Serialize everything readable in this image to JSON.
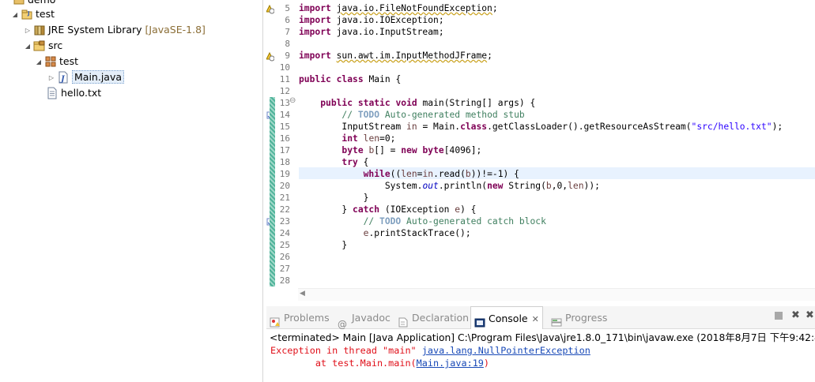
{
  "explorer": {
    "items": [
      {
        "label": "demo"
      },
      {
        "label": "test"
      },
      {
        "label": "JRE System Library",
        "decoration": "[JavaSE-1.8]"
      },
      {
        "label": "src"
      },
      {
        "label": "test"
      },
      {
        "label": "Main.java"
      },
      {
        "label": "hello.txt"
      }
    ]
  },
  "editor": {
    "lines": [
      {
        "n": "5",
        "tokens": [
          {
            "t": "import",
            "c": "kw"
          },
          {
            "t": " "
          },
          {
            "t": "java.io.FileNotFoundException",
            "c": "wv"
          },
          {
            "t": ";"
          }
        ]
      },
      {
        "n": "6",
        "tokens": [
          {
            "t": "import",
            "c": "kw"
          },
          {
            "t": " java.io.IOException;"
          }
        ]
      },
      {
        "n": "7",
        "tokens": [
          {
            "t": "import",
            "c": "kw"
          },
          {
            "t": " java.io.InputStream;"
          }
        ]
      },
      {
        "n": "8",
        "tokens": []
      },
      {
        "n": "9",
        "tokens": [
          {
            "t": "import",
            "c": "kw"
          },
          {
            "t": " "
          },
          {
            "t": "sun.awt.im.InputMethodJFrame",
            "c": "wv"
          },
          {
            "t": ";"
          }
        ]
      },
      {
        "n": "10",
        "tokens": []
      },
      {
        "n": "11",
        "tokens": [
          {
            "t": "public",
            "c": "kw"
          },
          {
            "t": " "
          },
          {
            "t": "class",
            "c": "kw"
          },
          {
            "t": " Main {"
          }
        ]
      },
      {
        "n": "12",
        "tokens": []
      },
      {
        "n": "13",
        "tokens": [
          {
            "t": "    "
          },
          {
            "t": "public",
            "c": "kw"
          },
          {
            "t": " "
          },
          {
            "t": "static",
            "c": "kw"
          },
          {
            "t": " "
          },
          {
            "t": "void",
            "c": "kw"
          },
          {
            "t": " main(String[] args) {"
          }
        ]
      },
      {
        "n": "14",
        "tokens": [
          {
            "t": "        "
          },
          {
            "t": "// ",
            "c": "cm"
          },
          {
            "t": "TODO",
            "c": "todo"
          },
          {
            "t": " Auto-generated method stub",
            "c": "cm"
          }
        ]
      },
      {
        "n": "15",
        "tokens": [
          {
            "t": "        InputStream "
          },
          {
            "t": "in",
            "c": "var"
          },
          {
            "t": " = Main."
          },
          {
            "t": "class",
            "c": "kw"
          },
          {
            "t": ".getClassLoader().getResourceAsStream("
          },
          {
            "t": "\"src/hello.txt\"",
            "c": "str"
          },
          {
            "t": ");"
          }
        ]
      },
      {
        "n": "16",
        "tokens": [
          {
            "t": "        "
          },
          {
            "t": "int",
            "c": "kw"
          },
          {
            "t": " "
          },
          {
            "t": "len",
            "c": "var"
          },
          {
            "t": "=0;"
          }
        ]
      },
      {
        "n": "17",
        "tokens": [
          {
            "t": "        "
          },
          {
            "t": "byte",
            "c": "kw"
          },
          {
            "t": " "
          },
          {
            "t": "b",
            "c": "var"
          },
          {
            "t": "[] = "
          },
          {
            "t": "new",
            "c": "kw"
          },
          {
            "t": " "
          },
          {
            "t": "byte",
            "c": "kw"
          },
          {
            "t": "[4096];"
          }
        ]
      },
      {
        "n": "18",
        "tokens": [
          {
            "t": "        "
          },
          {
            "t": "try",
            "c": "kw"
          },
          {
            "t": " {"
          }
        ]
      },
      {
        "n": "19",
        "tokens": [
          {
            "t": "            "
          },
          {
            "t": "while",
            "c": "kw"
          },
          {
            "t": "(("
          },
          {
            "t": "len",
            "c": "var"
          },
          {
            "t": "="
          },
          {
            "t": "in",
            "c": "var"
          },
          {
            "t": ".read("
          },
          {
            "t": "b",
            "c": "var"
          },
          {
            "t": "))!=-1) {"
          }
        ]
      },
      {
        "n": "20",
        "tokens": [
          {
            "t": "                System."
          },
          {
            "t": "out",
            "c": "fld"
          },
          {
            "t": ".println("
          },
          {
            "t": "new",
            "c": "kw"
          },
          {
            "t": " String("
          },
          {
            "t": "b",
            "c": "var"
          },
          {
            "t": ",0,"
          },
          {
            "t": "len",
            "c": "var"
          },
          {
            "t": "));"
          }
        ]
      },
      {
        "n": "21",
        "tokens": [
          {
            "t": "            }"
          }
        ]
      },
      {
        "n": "22",
        "tokens": [
          {
            "t": "        } "
          },
          {
            "t": "catch",
            "c": "kw"
          },
          {
            "t": " (IOException "
          },
          {
            "t": "e",
            "c": "var"
          },
          {
            "t": ") {"
          }
        ]
      },
      {
        "n": "23",
        "tokens": [
          {
            "t": "            "
          },
          {
            "t": "// ",
            "c": "cm"
          },
          {
            "t": "TODO",
            "c": "todo"
          },
          {
            "t": " Auto-generated catch block",
            "c": "cm"
          }
        ]
      },
      {
        "n": "24",
        "tokens": [
          {
            "t": "            "
          },
          {
            "t": "e",
            "c": "var"
          },
          {
            "t": ".printStackTrace();"
          }
        ]
      },
      {
        "n": "25",
        "tokens": [
          {
            "t": "        }"
          }
        ]
      },
      {
        "n": "26",
        "tokens": []
      },
      {
        "n": "27",
        "tokens": []
      },
      {
        "n": "28",
        "tokens": []
      }
    ]
  },
  "views": {
    "tabs": [
      {
        "label": "Problems",
        "icon": "problems-icon"
      },
      {
        "label": "Javadoc",
        "icon": "at-icon"
      },
      {
        "label": "Declaration",
        "icon": "declaration-icon"
      },
      {
        "label": "Console",
        "icon": "console-icon",
        "active": true
      },
      {
        "label": "Progress",
        "icon": "progress-icon"
      }
    ]
  },
  "console": {
    "terminated": "<terminated> Main [Java Application] C:\\Program Files\\Java\\jre1.8.0_171\\bin\\javaw.exe (2018年8月7日 下午9:42:48)",
    "line1_prefix": "Exception in thread \"main\" ",
    "line1_link": "java.lang.NullPointerException",
    "line2_prefix": "        at test.Main.main(",
    "line2_link": "Main.java:19",
    "line2_suffix": ")"
  },
  "colors": {
    "keyword": "#7f0055",
    "comment": "#3f7f5f",
    "string": "#2a00ff",
    "error": "#e0101a",
    "link": "#1849b7"
  }
}
